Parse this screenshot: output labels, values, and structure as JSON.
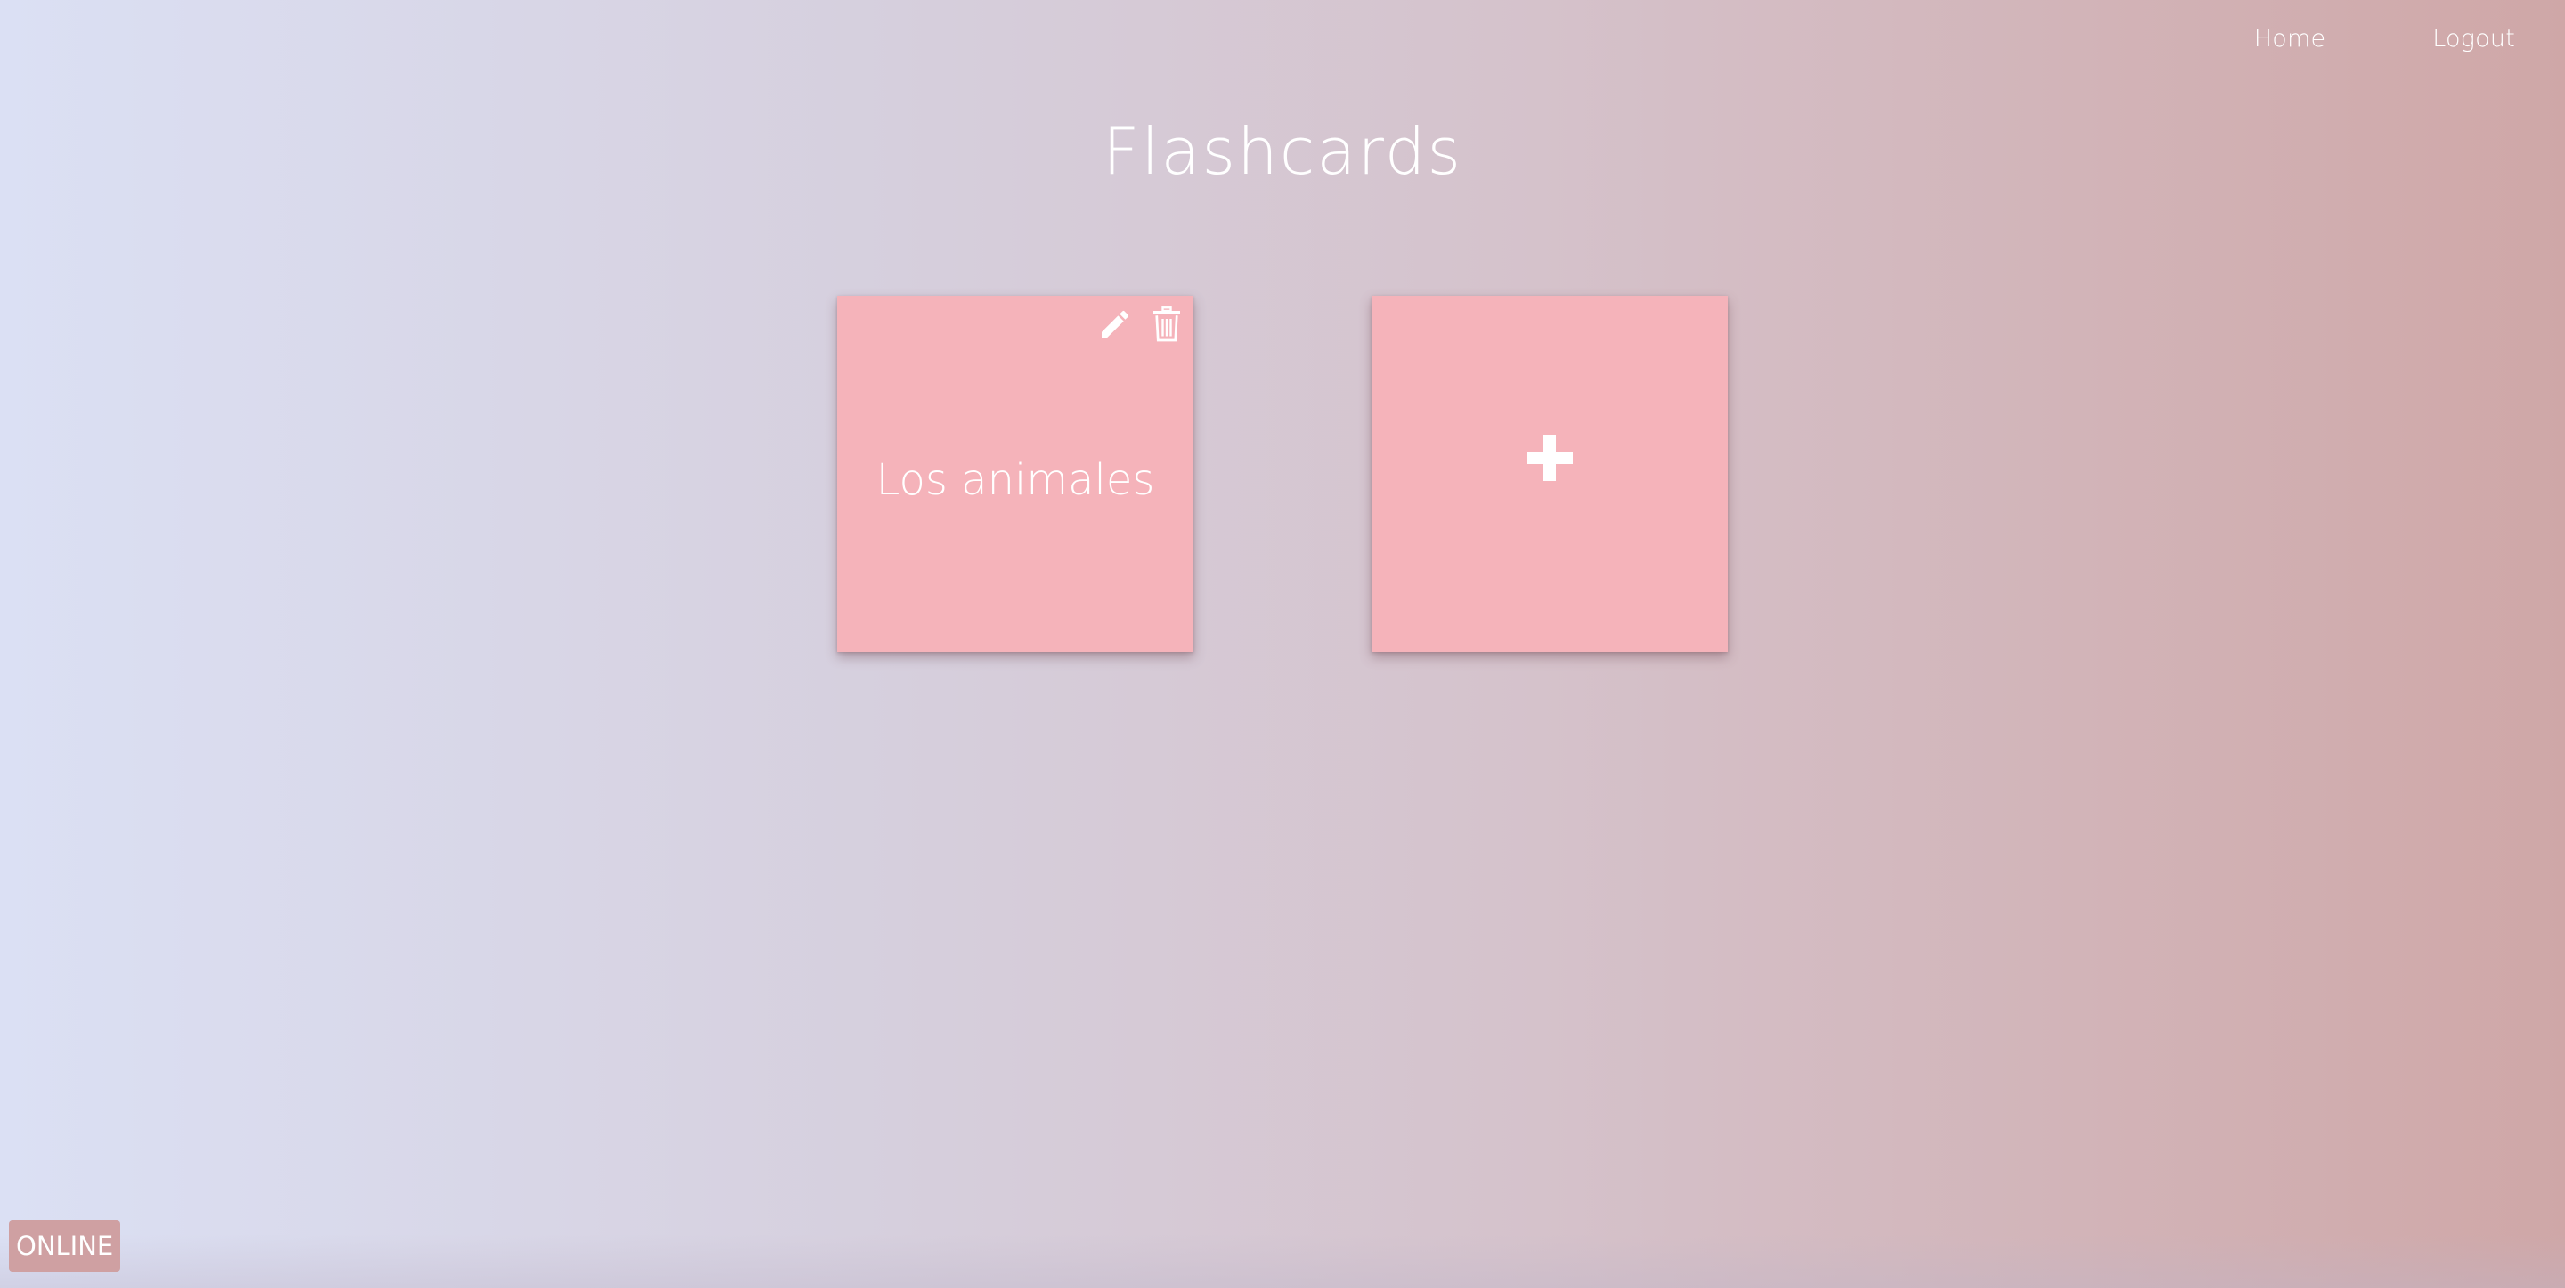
{
  "nav": {
    "home_label": "Home",
    "logout_label": "Logout"
  },
  "page": {
    "title": "Flashcards"
  },
  "decks": [
    {
      "label": "Los animales",
      "actions": [
        "edit-icon",
        "delete-icon"
      ]
    }
  ],
  "add_card": {
    "icon": "plus-icon"
  },
  "status": {
    "label": "ONLINE"
  },
  "colors": {
    "card": "#f5b3ba",
    "badge": "#cfa0a2",
    "gradient_left": "#dbe0f4",
    "gradient_right": "#cfa7a7",
    "text": "#ffffff"
  }
}
